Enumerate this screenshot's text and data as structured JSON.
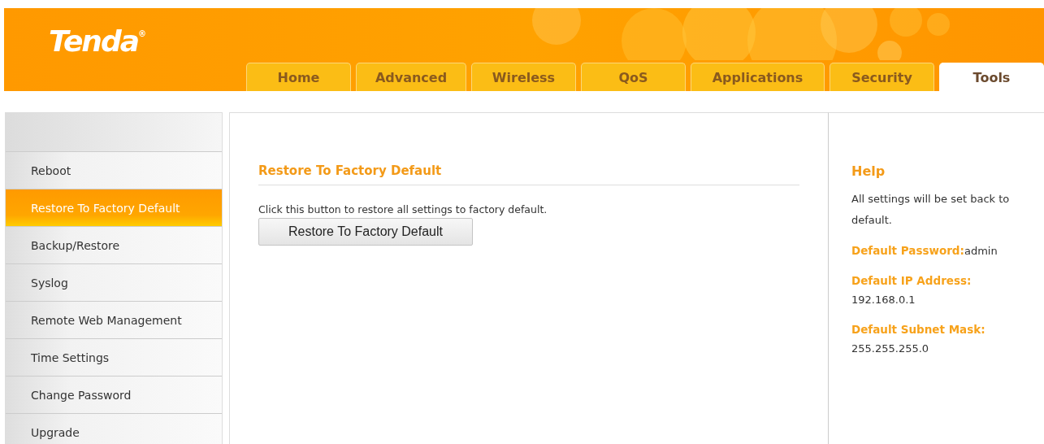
{
  "logo": "Tenda$^{®}$",
  "tabs": [
    {
      "label": "Home",
      "selected": false
    },
    {
      "label": "Advanced",
      "selected": false
    },
    {
      "label": "Wireless",
      "selected": false
    },
    {
      "label": "QoS",
      "selected": false
    },
    {
      "label": "Applications",
      "selected": false
    },
    {
      "label": "Security",
      "selected": false
    },
    {
      "label": "Tools",
      "selected": true
    }
  ],
  "sidebar": {
    "items": [
      {
        "label": "Reboot",
        "selected": false
      },
      {
        "label": "Restore To Factory Default",
        "selected": true
      },
      {
        "label": "Backup/Restore",
        "selected": false
      },
      {
        "label": "Syslog",
        "selected": false
      },
      {
        "label": "Remote Web Management",
        "selected": false
      },
      {
        "label": "Time Settings",
        "selected": false
      },
      {
        "label": "Change Password",
        "selected": false
      },
      {
        "label": "Upgrade",
        "selected": false
      }
    ]
  },
  "content": {
    "title": "Restore To Factory Default",
    "description": "Click this button to restore all settings to factory default.",
    "button": "Restore To Factory Default"
  },
  "help": {
    "title": "Help",
    "text": "All settings will be set back to default.",
    "entries": [
      {
        "label": "Default Password:",
        "value": "admin",
        "inline": true
      },
      {
        "label": "Default IP Address:",
        "value": "192.168.0.1",
        "inline": false
      },
      {
        "label": "Default Subnet Mask:",
        "value": "255.255.255.0",
        "inline": false
      }
    ]
  }
}
